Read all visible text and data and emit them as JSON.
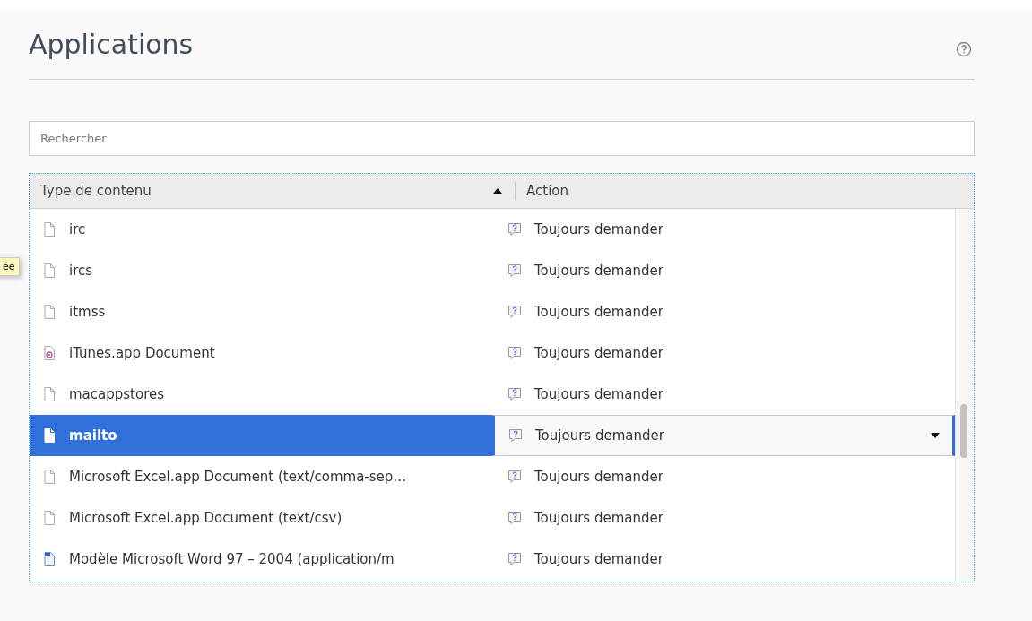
{
  "title": "Applications",
  "search": {
    "placeholder": "Rechercher"
  },
  "tooltip": "ée",
  "table": {
    "columns": [
      {
        "label": "Type de contenu",
        "sort_ascending": true
      },
      {
        "label": "Action"
      }
    ],
    "rows": [
      {
        "type": "irc",
        "kind": "generic",
        "action": "Toujours demander",
        "selected": false
      },
      {
        "type": "ircs",
        "kind": "generic",
        "action": "Toujours demander",
        "selected": false
      },
      {
        "type": "itmss",
        "kind": "generic",
        "action": "Toujours demander",
        "selected": false
      },
      {
        "type": "iTunes.app Document",
        "kind": "itunes",
        "action": "Toujours demander",
        "selected": false
      },
      {
        "type": "macappstores",
        "kind": "generic",
        "action": "Toujours demander",
        "selected": false
      },
      {
        "type": "mailto",
        "kind": "generic",
        "action": "Toujours demander",
        "selected": true
      },
      {
        "type": "Microsoft Excel.app Document (text/comma-sep…",
        "kind": "generic",
        "action": "Toujours demander",
        "selected": false
      },
      {
        "type": "Microsoft Excel.app Document (text/csv)",
        "kind": "generic",
        "action": "Toujours demander",
        "selected": false
      },
      {
        "type": "Modèle Microsoft Word 97 – 2004 (application/m",
        "kind": "word",
        "action": "Toujours demander",
        "selected": false
      }
    ]
  }
}
